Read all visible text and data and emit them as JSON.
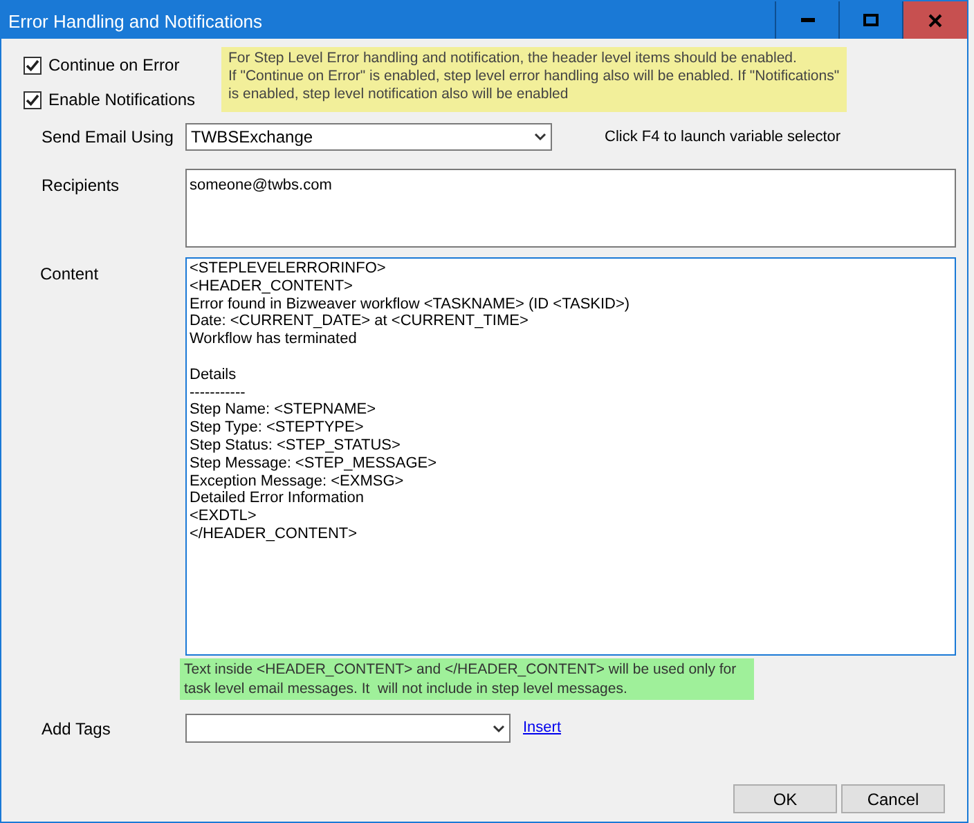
{
  "window": {
    "title": "Error Handling and Notifications"
  },
  "options": [
    {
      "label": "Continue on Error",
      "checked": true
    },
    {
      "label": "Enable Notifications",
      "checked": true
    }
  ],
  "header_note": [
    "For Step Level Error handling and notification, the header level items should be enabled.",
    "If \"Continue on Error\" is enabled, step level error handling also will be enabled. If \"Notifications\"",
    "is enabled, step level notification also will be enabled"
  ],
  "send_email": {
    "label": "Send Email Using",
    "value": "TWBSExchange",
    "hint": "Click F4 to launch variable selector"
  },
  "recipients": {
    "label": "Recipients",
    "value": "someone@twbs.com"
  },
  "content": {
    "label": "Content",
    "blocks": [
      [
        "<STEPLEVELERRORINFO>",
        "<HEADER_CONTENT>",
        "Error found in Bizweaver workflow <TASKNAME> (ID <TASKID>)",
        "Date: <CURRENT_DATE> at <CURRENT_TIME>",
        "Workflow has terminated"
      ],
      [
        "Details",
        "-----------",
        "Step Name: <STEPNAME>",
        "Step Type: <STEPTYPE>",
        "Step Status: <STEP_STATUS>",
        "Step Message: <STEP_MESSAGE>",
        "Exception Message: <EXMSG>",
        "Detailed Error Information",
        "<EXDTL>",
        "</HEADER_CONTENT>"
      ]
    ]
  },
  "content_note": [
    "Text inside <HEADER_CONTENT> and </HEADER_CONTENT> will be used only for",
    "task level email messages. It  will not include in step level messages."
  ],
  "add_tags": {
    "label": "Add Tags",
    "link": "Insert"
  },
  "buttons": [
    "OK",
    "Cancel"
  ]
}
